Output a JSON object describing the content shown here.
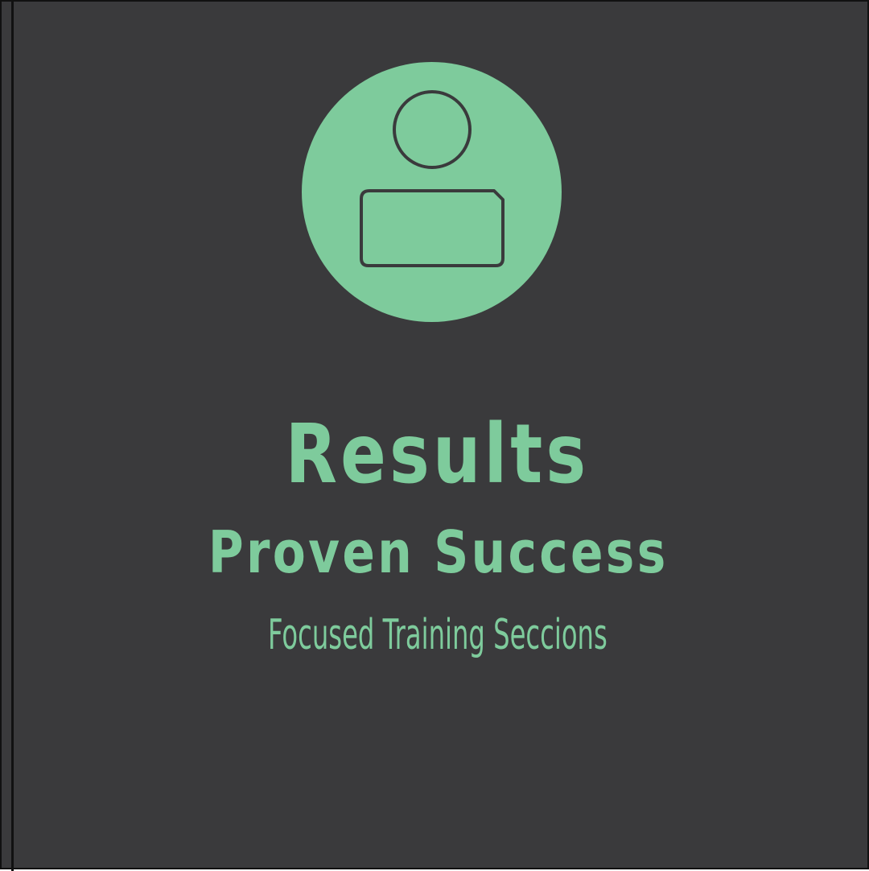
{
  "colors": {
    "background": "#3a3a3c",
    "accent": "#7ecb9c",
    "outline": "#3a3a3c",
    "border": "#111111"
  },
  "avatar": {
    "icon": "user-icon"
  },
  "content": {
    "title": "Results",
    "subtitle": "Proven Success",
    "tagline": "Focused Training Seccions"
  }
}
